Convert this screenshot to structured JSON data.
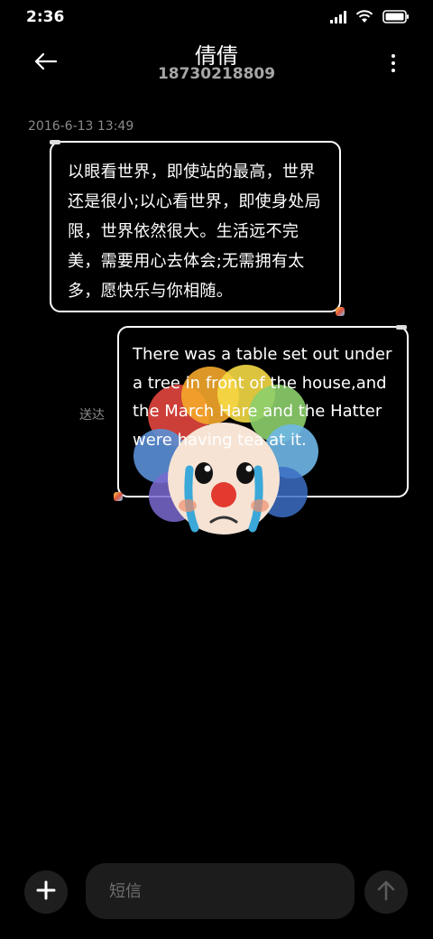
{
  "status_bar": {
    "time": "2:36",
    "icons": [
      "signal-icon",
      "wifi-icon",
      "battery-icon"
    ]
  },
  "header": {
    "contact_name": "倩倩",
    "phone_number": "18730218809",
    "back_icon": "back-arrow-icon",
    "more_icon": "more-vertical-icon"
  },
  "conversation": {
    "timestamp": "2016-6-13 13:49",
    "messages": [
      {
        "direction": "incoming",
        "text": "以眼看世界，即使站的最高，世界还是很小;以心看世界，即使身处局限，世界依然很大。生活远不完美，需要用心去体会;无需拥有太多，愿快乐与你相随。"
      },
      {
        "direction": "outgoing",
        "text": "There was a table set out under a tree in front of the house,and the March Hare and the Hatter were having tea at it.",
        "status": "送达",
        "sticker": "crying-clown-sticker"
      }
    ]
  },
  "composer": {
    "placeholder": "短信",
    "value": "",
    "add_icon": "plus-icon",
    "send_icon": "arrow-up-icon"
  },
  "colors": {
    "background": "#000000",
    "bubble_border": "#ffffff",
    "input_background": "#1c1c1c",
    "muted_text": "#8a8a8a"
  }
}
